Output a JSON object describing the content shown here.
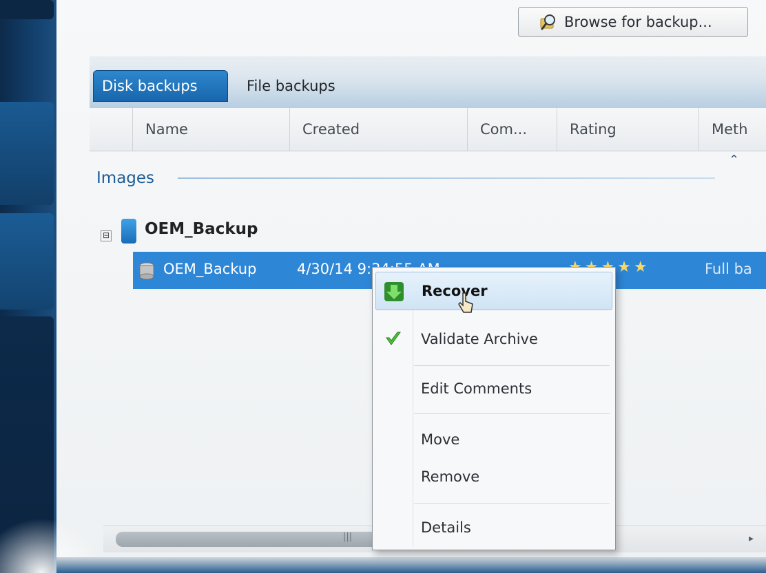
{
  "toolbar": {
    "browse_label": "Browse for backup...",
    "browse_icon": "magnifier-folder-icon"
  },
  "tabs": [
    {
      "label": "Disk backups",
      "active": true
    },
    {
      "label": "File backups",
      "active": false
    }
  ],
  "columns": [
    "Name",
    "Created",
    "Com...",
    "Rating",
    "Meth"
  ],
  "group": {
    "label": "Images",
    "collapse_glyph": "⌃"
  },
  "tree": {
    "toggle_glyph": "⊟",
    "parent_label": "OEM_Backup",
    "selected_row": {
      "name": "OEM_Backup",
      "created": "4/30/14 9:34:55 AM",
      "rating_stars": 5,
      "rating_glyphs": "★★★★★",
      "method": "Full ba"
    }
  },
  "context_menu": {
    "items": [
      {
        "label": "Recover",
        "icon": "green-down-arrow-icon",
        "highlighted": true
      },
      {
        "label": "Validate Archive",
        "icon": "green-checkmark-icon",
        "highlighted": false
      },
      {
        "label": "Edit Comments",
        "icon": "",
        "highlighted": false
      },
      {
        "label": "Move",
        "icon": "",
        "highlighted": false
      },
      {
        "label": "Remove",
        "icon": "",
        "highlighted": false
      },
      {
        "label": "Details",
        "icon": "",
        "highlighted": false
      }
    ]
  },
  "scrollbar": {
    "grip_glyph": "|||",
    "right_arrow_glyph": "▸"
  },
  "colors": {
    "accent": "#2e86d6",
    "tab_active": "#1866ad",
    "sidebar": "#13406d",
    "group_label": "#1d5d97"
  }
}
